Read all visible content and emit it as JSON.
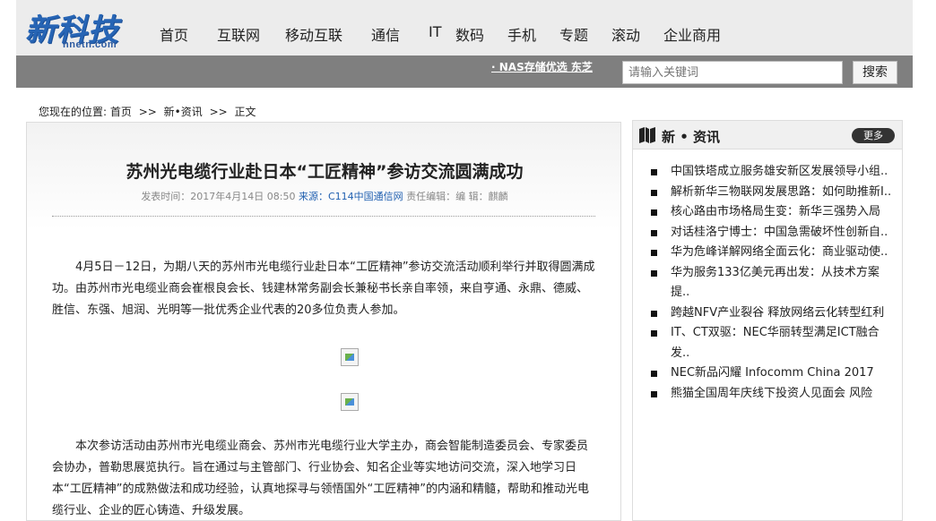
{
  "logo": {
    "main": "新科技",
    "sub": "hnetn.com"
  },
  "nav": [
    "首页",
    "互联网",
    "移动互联",
    "通信",
    "IT",
    "数码",
    "手机",
    "专题",
    "滚动",
    "企业商用"
  ],
  "ticker": {
    "text": "· NAS存储优选  东芝"
  },
  "search": {
    "placeholder": "请输入关键词",
    "button": "搜索"
  },
  "breadcrumb": {
    "prefix": "您现在的位置:",
    "items": [
      "首页",
      "新•资讯",
      "正文"
    ],
    "sep": ">>"
  },
  "article": {
    "title": "苏州光电缆行业赴日本“工匠精神”参访交流圆满成功",
    "meta_time": "发表时间：2017年4月14日 08:50",
    "meta_source": "来源：C114中国通信网",
    "meta_editor": "责任编辑：编 辑：麒麟",
    "para1": "4月5日－12日，为期八天的苏州市光电缆行业赴日本“工匠精神”参访交流活动顺利举行并取得圆满成功。由苏州市光电缆业商会崔根良会长、钱建林常务副会长兼秘书长亲自率领，来自亨通、永鼎、德威、胜信、东强、旭润、光明等一批优秀企业代表的20多位负责人参加。",
    "para2": "本次参访活动由苏州市光电缆业商会、苏州市光电缆行业大学主办，商会智能制造委员会、专家委员会协办，普勒思展览执行。旨在通过与主管部门、行业协会、知名企业等实地访问交流，深入地学习日本“工匠精神”的成熟做法和成功经验，认真地探寻与领悟国外“工匠精神”的内涵和精髓，帮助和推动光电缆行业、企业的匠心铸造、升级发展。"
  },
  "sidebar": {
    "title": "新 • 资讯",
    "more": "更多",
    "items": [
      "中国铁塔成立服务雄安新区发展领导小组..",
      "解析新华三物联网发展思路：如何助推新I..",
      "核心路由市场格局生变：新华三强势入局",
      "对话桂洛宁博士：中国急需破坏性创新自..",
      "华为危峰详解网络全面云化：商业驱动使..",
      "华为服务133亿美元再出发：从技术方案提..",
      "跨越NFV产业裂谷 释放网络云化转型红利",
      "IT、CT双驱：NEC华丽转型满足ICT融合发..",
      "NEC新品闪耀 Infocomm China 2017",
      "熊猫全国周年庆线下投资人见面会 风险"
    ]
  }
}
